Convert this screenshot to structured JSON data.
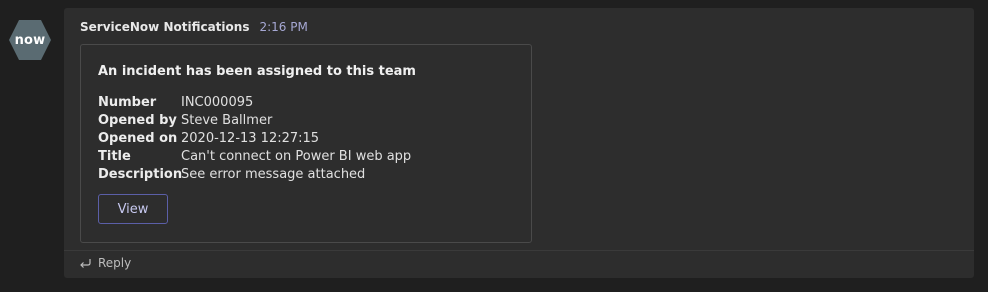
{
  "avatar": {
    "text": "now",
    "icon": "servicenow-hexagon-logo",
    "bg_color": "#5a6b72"
  },
  "message": {
    "sender": "ServiceNow Notifications",
    "time": "2:16 PM",
    "time_color": "#a6a8d4"
  },
  "card": {
    "title": "An incident has been assigned to this team",
    "facts": [
      {
        "label": "Number",
        "value": "INC000095"
      },
      {
        "label": "Opened by",
        "value": "Steve Ballmer"
      },
      {
        "label": "Opened on",
        "value": "2020-12-13 12:27:15"
      },
      {
        "label": "Title",
        "value": "Can't connect on Power BI web app"
      },
      {
        "label": "Description",
        "value": "See error message attached"
      }
    ],
    "action_label": "View",
    "action_color": "#5b5fa8"
  },
  "reply": {
    "label": "Reply",
    "icon": "reply-arrow-icon"
  }
}
